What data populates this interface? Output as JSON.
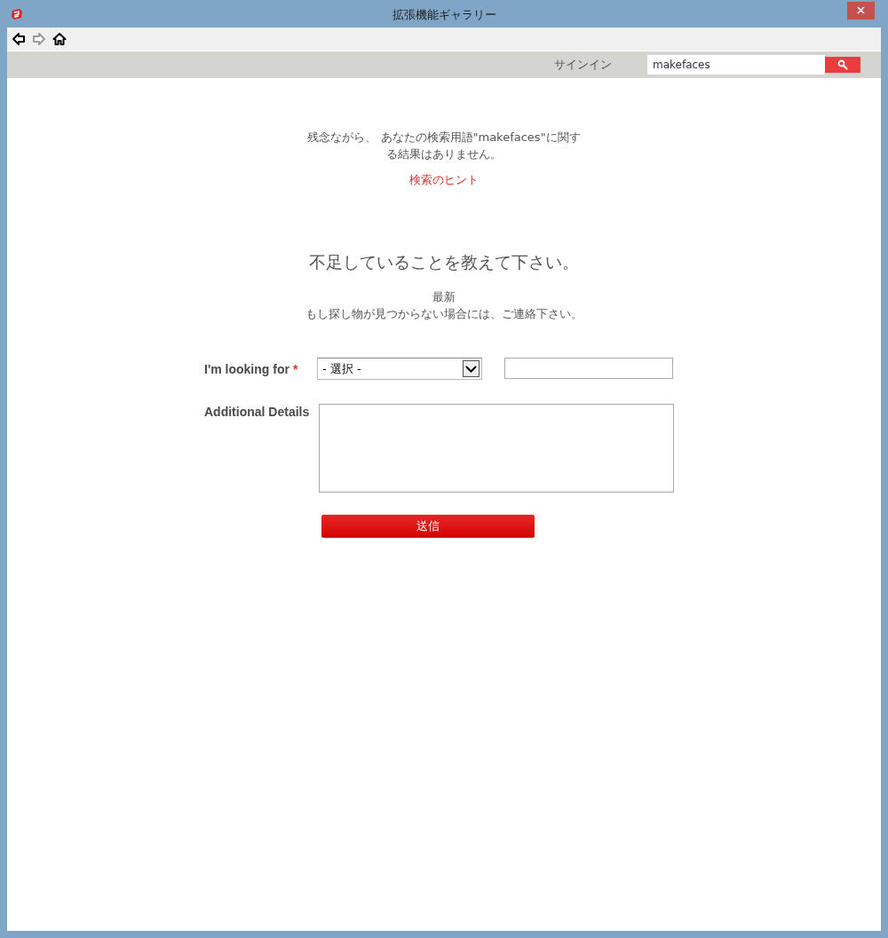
{
  "window": {
    "title": "拡張機能ギャラリー"
  },
  "nav": [
    {
      "kind": "back",
      "disabled": false
    },
    {
      "kind": "forward",
      "disabled": true
    },
    {
      "kind": "home",
      "disabled": false
    }
  ],
  "header": {
    "sign_in": "サインイン",
    "search": {
      "value": "makefaces"
    }
  },
  "message": "残念ながら、 あなたの検索用語\"makefaces\"に関する結果はありません。",
  "hint_link": "検索のヒント",
  "heading": "不足していることを教えて下さい。",
  "subheading": "最新",
  "subtext": "もし探し物が見つからない場合には、ご連絡下さい。",
  "form": {
    "looking_for": {
      "label": "I'm looking for",
      "required_mark": "*",
      "select": "- 選択 -"
    },
    "details": {
      "label": "Additional Details"
    },
    "submit": "送信"
  }
}
